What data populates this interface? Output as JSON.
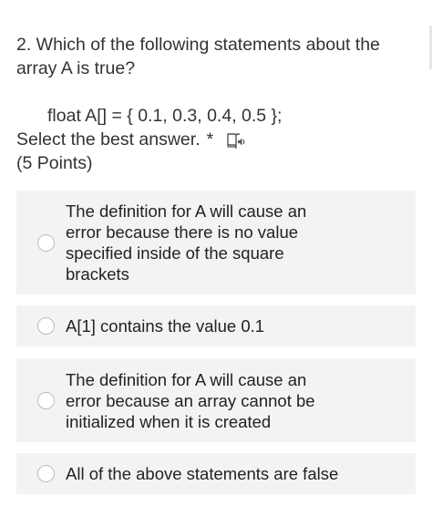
{
  "question": {
    "title": "2. Which of the following statements about the array A is true?",
    "code": "float A[] = { 0.1, 0.3, 0.4, 0.5 };",
    "instruction": "Select the best answer.",
    "required_marker": "*",
    "points": "(5 Points)",
    "reader_icon": "immersive-reader-icon"
  },
  "options": [
    {
      "label": "The definition for A will cause an error because there is no value specified inside of the square brackets",
      "selected": false
    },
    {
      "label": "A[1] contains the value 0.1",
      "selected": false
    },
    {
      "label": "The definition for A will cause an error because an array cannot be initialized when it is created",
      "selected": false
    },
    {
      "label": "All of the above statements are false",
      "selected": false
    }
  ],
  "colors": {
    "text": "#333333",
    "option_background": "#f3f3f3",
    "radio_border": "#bcbcbc",
    "icon": "#555555"
  }
}
